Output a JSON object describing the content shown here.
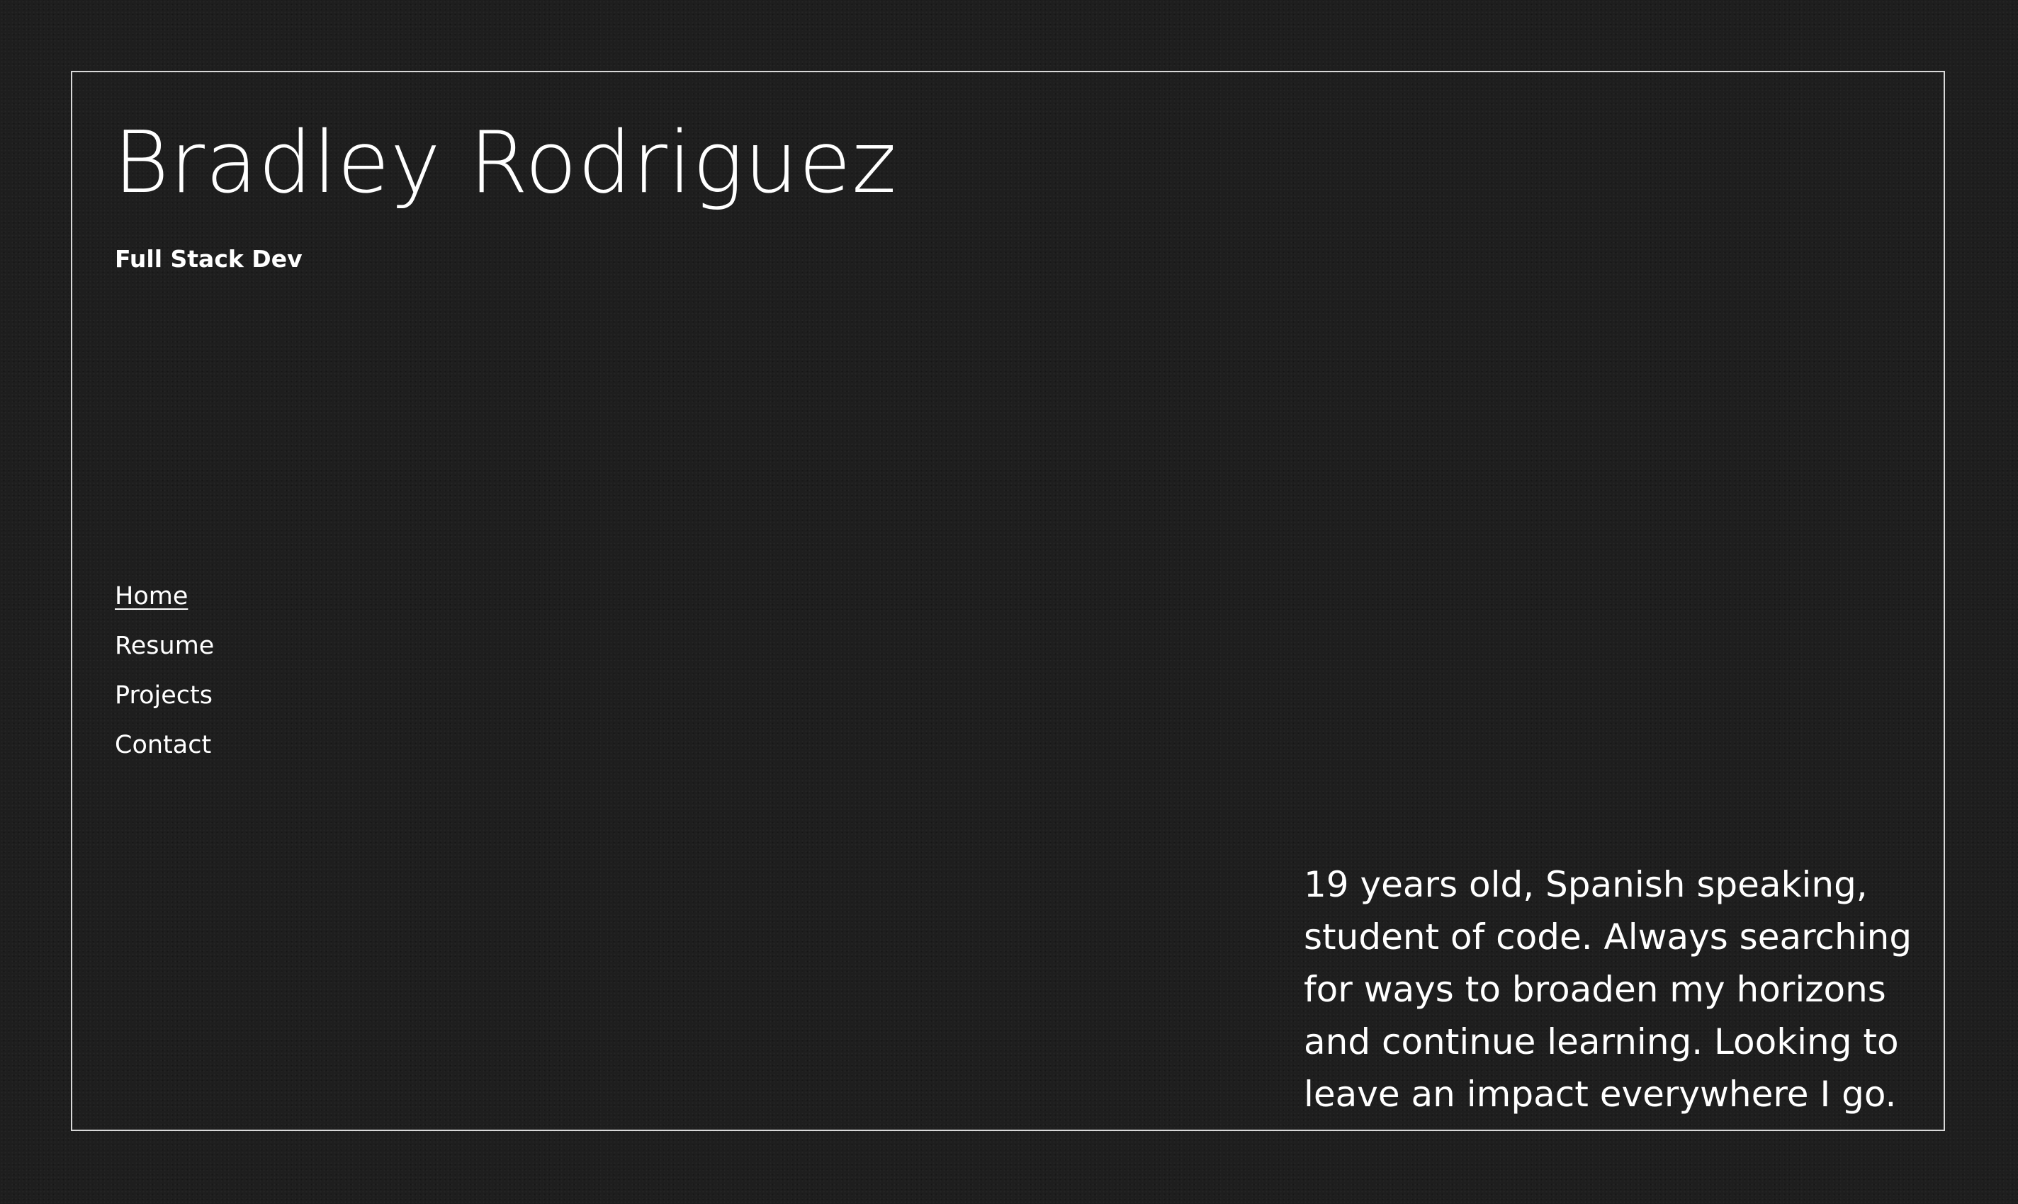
{
  "header": {
    "title": "Bradley Rodriguez",
    "subtitle": "Full Stack Dev"
  },
  "nav": {
    "items": [
      {
        "label": "Home",
        "active": true
      },
      {
        "label": "Resume",
        "active": false
      },
      {
        "label": "Projects",
        "active": false
      },
      {
        "label": "Contact",
        "active": false
      }
    ]
  },
  "bio": {
    "text": "19 years old, Spanish speaking, student of code. Always searching for ways to broaden my horizons and continue learning. Looking to leave an impact everywhere I go."
  },
  "colors": {
    "background": "#1e1e1e",
    "text": "#ffffff",
    "frame_border": "#d8d8d8"
  }
}
